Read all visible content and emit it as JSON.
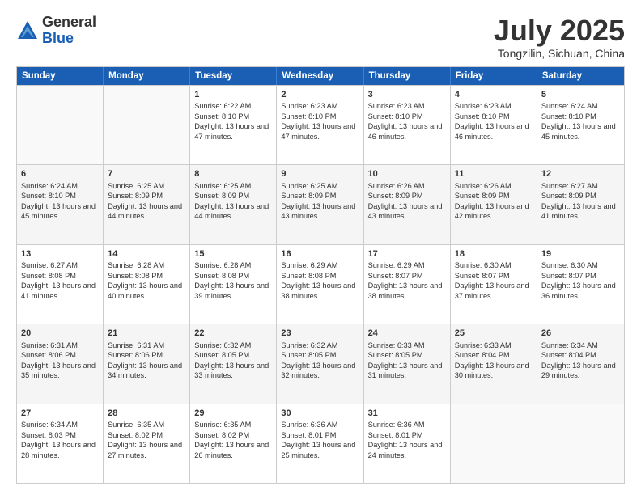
{
  "logo": {
    "general": "General",
    "blue": "Blue"
  },
  "title": "July 2025",
  "location": "Tongzilin, Sichuan, China",
  "weekdays": [
    "Sunday",
    "Monday",
    "Tuesday",
    "Wednesday",
    "Thursday",
    "Friday",
    "Saturday"
  ],
  "rows": [
    [
      {
        "day": "",
        "info": ""
      },
      {
        "day": "",
        "info": ""
      },
      {
        "day": "1",
        "info": "Sunrise: 6:22 AM\nSunset: 8:10 PM\nDaylight: 13 hours and 47 minutes."
      },
      {
        "day": "2",
        "info": "Sunrise: 6:23 AM\nSunset: 8:10 PM\nDaylight: 13 hours and 47 minutes."
      },
      {
        "day": "3",
        "info": "Sunrise: 6:23 AM\nSunset: 8:10 PM\nDaylight: 13 hours and 46 minutes."
      },
      {
        "day": "4",
        "info": "Sunrise: 6:23 AM\nSunset: 8:10 PM\nDaylight: 13 hours and 46 minutes."
      },
      {
        "day": "5",
        "info": "Sunrise: 6:24 AM\nSunset: 8:10 PM\nDaylight: 13 hours and 45 minutes."
      }
    ],
    [
      {
        "day": "6",
        "info": "Sunrise: 6:24 AM\nSunset: 8:10 PM\nDaylight: 13 hours and 45 minutes."
      },
      {
        "day": "7",
        "info": "Sunrise: 6:25 AM\nSunset: 8:09 PM\nDaylight: 13 hours and 44 minutes."
      },
      {
        "day": "8",
        "info": "Sunrise: 6:25 AM\nSunset: 8:09 PM\nDaylight: 13 hours and 44 minutes."
      },
      {
        "day": "9",
        "info": "Sunrise: 6:25 AM\nSunset: 8:09 PM\nDaylight: 13 hours and 43 minutes."
      },
      {
        "day": "10",
        "info": "Sunrise: 6:26 AM\nSunset: 8:09 PM\nDaylight: 13 hours and 43 minutes."
      },
      {
        "day": "11",
        "info": "Sunrise: 6:26 AM\nSunset: 8:09 PM\nDaylight: 13 hours and 42 minutes."
      },
      {
        "day": "12",
        "info": "Sunrise: 6:27 AM\nSunset: 8:09 PM\nDaylight: 13 hours and 41 minutes."
      }
    ],
    [
      {
        "day": "13",
        "info": "Sunrise: 6:27 AM\nSunset: 8:08 PM\nDaylight: 13 hours and 41 minutes."
      },
      {
        "day": "14",
        "info": "Sunrise: 6:28 AM\nSunset: 8:08 PM\nDaylight: 13 hours and 40 minutes."
      },
      {
        "day": "15",
        "info": "Sunrise: 6:28 AM\nSunset: 8:08 PM\nDaylight: 13 hours and 39 minutes."
      },
      {
        "day": "16",
        "info": "Sunrise: 6:29 AM\nSunset: 8:08 PM\nDaylight: 13 hours and 38 minutes."
      },
      {
        "day": "17",
        "info": "Sunrise: 6:29 AM\nSunset: 8:07 PM\nDaylight: 13 hours and 38 minutes."
      },
      {
        "day": "18",
        "info": "Sunrise: 6:30 AM\nSunset: 8:07 PM\nDaylight: 13 hours and 37 minutes."
      },
      {
        "day": "19",
        "info": "Sunrise: 6:30 AM\nSunset: 8:07 PM\nDaylight: 13 hours and 36 minutes."
      }
    ],
    [
      {
        "day": "20",
        "info": "Sunrise: 6:31 AM\nSunset: 8:06 PM\nDaylight: 13 hours and 35 minutes."
      },
      {
        "day": "21",
        "info": "Sunrise: 6:31 AM\nSunset: 8:06 PM\nDaylight: 13 hours and 34 minutes."
      },
      {
        "day": "22",
        "info": "Sunrise: 6:32 AM\nSunset: 8:05 PM\nDaylight: 13 hours and 33 minutes."
      },
      {
        "day": "23",
        "info": "Sunrise: 6:32 AM\nSunset: 8:05 PM\nDaylight: 13 hours and 32 minutes."
      },
      {
        "day": "24",
        "info": "Sunrise: 6:33 AM\nSunset: 8:05 PM\nDaylight: 13 hours and 31 minutes."
      },
      {
        "day": "25",
        "info": "Sunrise: 6:33 AM\nSunset: 8:04 PM\nDaylight: 13 hours and 30 minutes."
      },
      {
        "day": "26",
        "info": "Sunrise: 6:34 AM\nSunset: 8:04 PM\nDaylight: 13 hours and 29 minutes."
      }
    ],
    [
      {
        "day": "27",
        "info": "Sunrise: 6:34 AM\nSunset: 8:03 PM\nDaylight: 13 hours and 28 minutes."
      },
      {
        "day": "28",
        "info": "Sunrise: 6:35 AM\nSunset: 8:02 PM\nDaylight: 13 hours and 27 minutes."
      },
      {
        "day": "29",
        "info": "Sunrise: 6:35 AM\nSunset: 8:02 PM\nDaylight: 13 hours and 26 minutes."
      },
      {
        "day": "30",
        "info": "Sunrise: 6:36 AM\nSunset: 8:01 PM\nDaylight: 13 hours and 25 minutes."
      },
      {
        "day": "31",
        "info": "Sunrise: 6:36 AM\nSunset: 8:01 PM\nDaylight: 13 hours and 24 minutes."
      },
      {
        "day": "",
        "info": ""
      },
      {
        "day": "",
        "info": ""
      }
    ]
  ]
}
